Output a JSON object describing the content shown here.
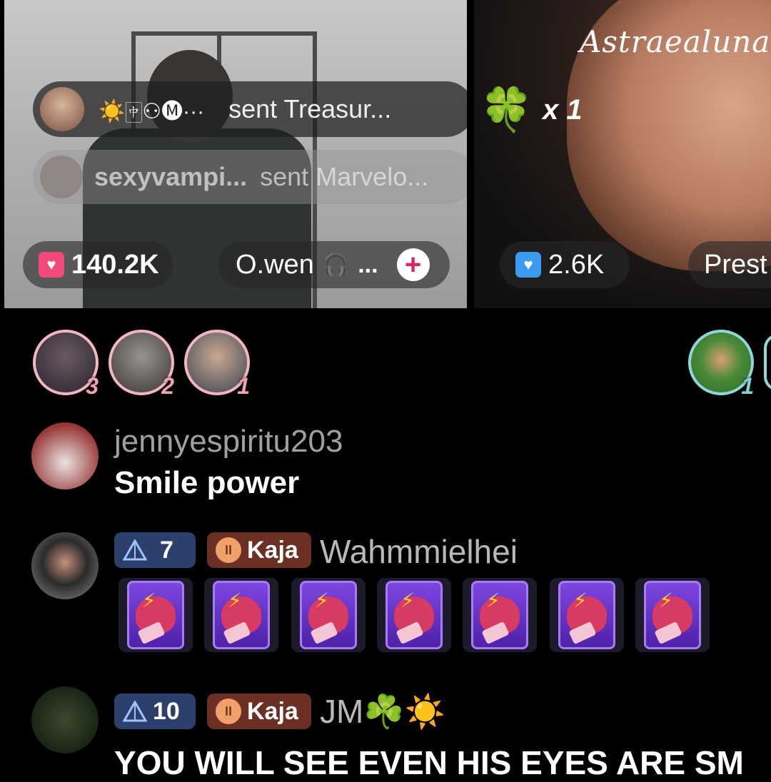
{
  "stream_left": {
    "gift_banner_1": {
      "sender": "☀️🀄︎⚇🅜···",
      "action": "sent Treasur..."
    },
    "gift_banner_2": {
      "sender": "sexyvampi...",
      "action": "sent Marvelo..."
    },
    "gift_count": "140.2K",
    "host_name": "O.wen",
    "host_suffix": "...",
    "follow_symbol": "+"
  },
  "stream_right": {
    "gift_icon": "🍀",
    "multiplier": "x 1",
    "gift_count": "2.6K",
    "host_name": "Prest",
    "watermark": "Astraealuna"
  },
  "top_gifters_left": [
    {
      "rank": "3",
      "color": "#e8a7b8"
    },
    {
      "rank": "2",
      "color": "#e8a7b8"
    },
    {
      "rank": "1",
      "color": "#e8a7b8"
    }
  ],
  "top_gifters_right": [
    {
      "rank": "1",
      "color": "#7fd3d6"
    }
  ],
  "chat": [
    {
      "username": "jennyespiritu203",
      "message": "Smile power"
    },
    {
      "level": "7",
      "fan_badge": "Kaja",
      "username": "Wahmmielhei",
      "gift_icon": "boxing-glove-card",
      "gift_count": 7
    },
    {
      "level": "10",
      "fan_badge": "Kaja",
      "username": "JM☘️☀️",
      "message": "YOU WILL SEE EVEN HIS EYES ARE SM"
    }
  ],
  "colors": {
    "gift_pink": "#f0497a",
    "gift_blue": "#3a9bf0",
    "level_badge": "#2d3f6b",
    "fan_badge": "#6b2f24"
  }
}
